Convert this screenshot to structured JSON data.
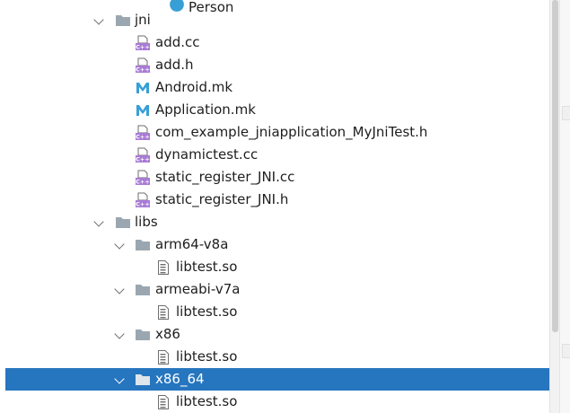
{
  "tree": {
    "partial_top": "Person",
    "rows": [
      {
        "label": "jni",
        "type": "folder",
        "expanded": true
      },
      {
        "label": "add.cc",
        "type": "cpp"
      },
      {
        "label": "add.h",
        "type": "cpp"
      },
      {
        "label": "Android.mk",
        "type": "mk"
      },
      {
        "label": "Application.mk",
        "type": "mk"
      },
      {
        "label": "com_example_jniapplication_MyJniTest.h",
        "type": "cpp"
      },
      {
        "label": "dynamictest.cc",
        "type": "cpp"
      },
      {
        "label": "static_register_JNI.cc",
        "type": "cpp"
      },
      {
        "label": "static_register_JNI.h",
        "type": "cpp"
      },
      {
        "label": "libs",
        "type": "folder",
        "expanded": true
      },
      {
        "label": "arm64-v8a",
        "type": "folder",
        "expanded": true
      },
      {
        "label": "libtest.so",
        "type": "so"
      },
      {
        "label": "armeabi-v7a",
        "type": "folder",
        "expanded": true
      },
      {
        "label": "libtest.so",
        "type": "so"
      },
      {
        "label": "x86",
        "type": "folder",
        "expanded": true
      },
      {
        "label": "libtest.so",
        "type": "so"
      },
      {
        "label": "x86_64",
        "type": "folder",
        "expanded": true,
        "selected": true
      },
      {
        "label": "libtest.so",
        "type": "so"
      }
    ]
  },
  "icons": {
    "folder": "folder-icon",
    "cpp": "cpp-file-icon",
    "mk": "makefile-icon",
    "so": "binary-file-icon",
    "chevron": "chevron-down-icon"
  },
  "colors": {
    "selection": "#2675bf",
    "folder": "#9aa7b0",
    "cpp_badge": "#a87bd6",
    "mk_letter": "#389fd6",
    "text": "#1e1e1e"
  }
}
